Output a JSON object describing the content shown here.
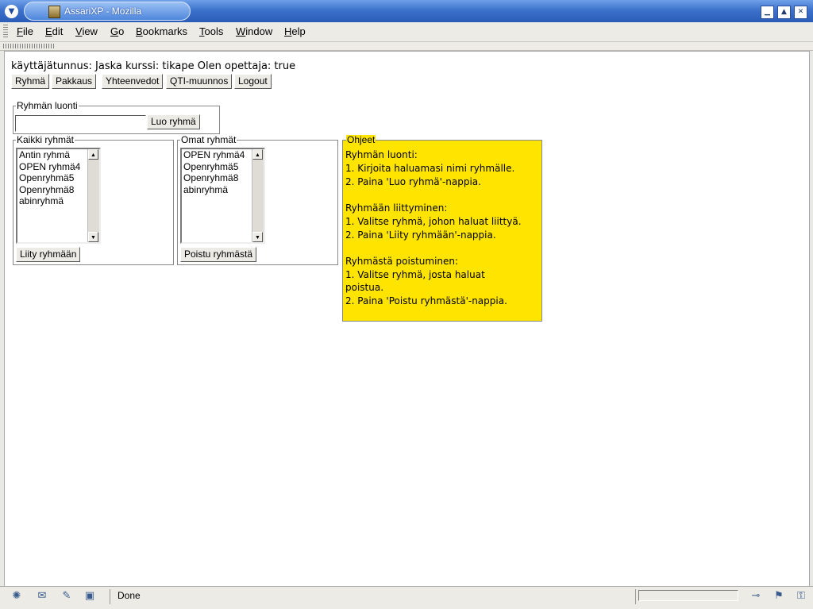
{
  "window": {
    "title": "AssariXP - Mozilla"
  },
  "menu": [
    "File",
    "Edit",
    "View",
    "Go",
    "Bookmarks",
    "Tools",
    "Window",
    "Help"
  ],
  "page": {
    "info": "käyttäjätunnus: Jaska kurssi: tikape Olen opettaja: true",
    "nav_buttons": [
      "Ryhmä",
      "Pakkaus",
      "Yhteenvedot",
      "QTI-muunnos",
      "Logout"
    ],
    "create_group": {
      "legend": "Ryhmän luonti",
      "input_value": "",
      "button": "Luo ryhmä"
    },
    "all_groups": {
      "legend": "Kaikki ryhmät",
      "options": [
        "Antin ryhmä",
        "OPEN ryhmä4",
        "Openryhmä5",
        "Openryhmä8",
        "abinryhmä"
      ],
      "button": "Liity ryhmään"
    },
    "own_groups": {
      "legend": "Omat ryhmät",
      "options": [
        "OPEN ryhmä4",
        "Openryhmä5",
        "Openryhmä8",
        "abinryhmä"
      ],
      "button": "Poistu ryhmästä"
    },
    "help": {
      "legend": "Ohjeet",
      "bg_color": "#ffe400",
      "lines": [
        "Ryhmän luonti:",
        "1. Kirjoita haluamasi nimi ryhmälle.",
        "2. Paina 'Luo ryhmä'-nappia.",
        "Ryhmään liittyminen:",
        "1. Valitse ryhmä, johon haluat liittyä.",
        "2. Paina 'Liity ryhmään'-nappia.",
        "Ryhmästä poistuminen:",
        "1. Valitse ryhmä, josta haluat",
        "poistua.",
        "2. Paina 'Poistu ryhmästä'-nappia."
      ]
    }
  },
  "status": {
    "text": "Done"
  }
}
